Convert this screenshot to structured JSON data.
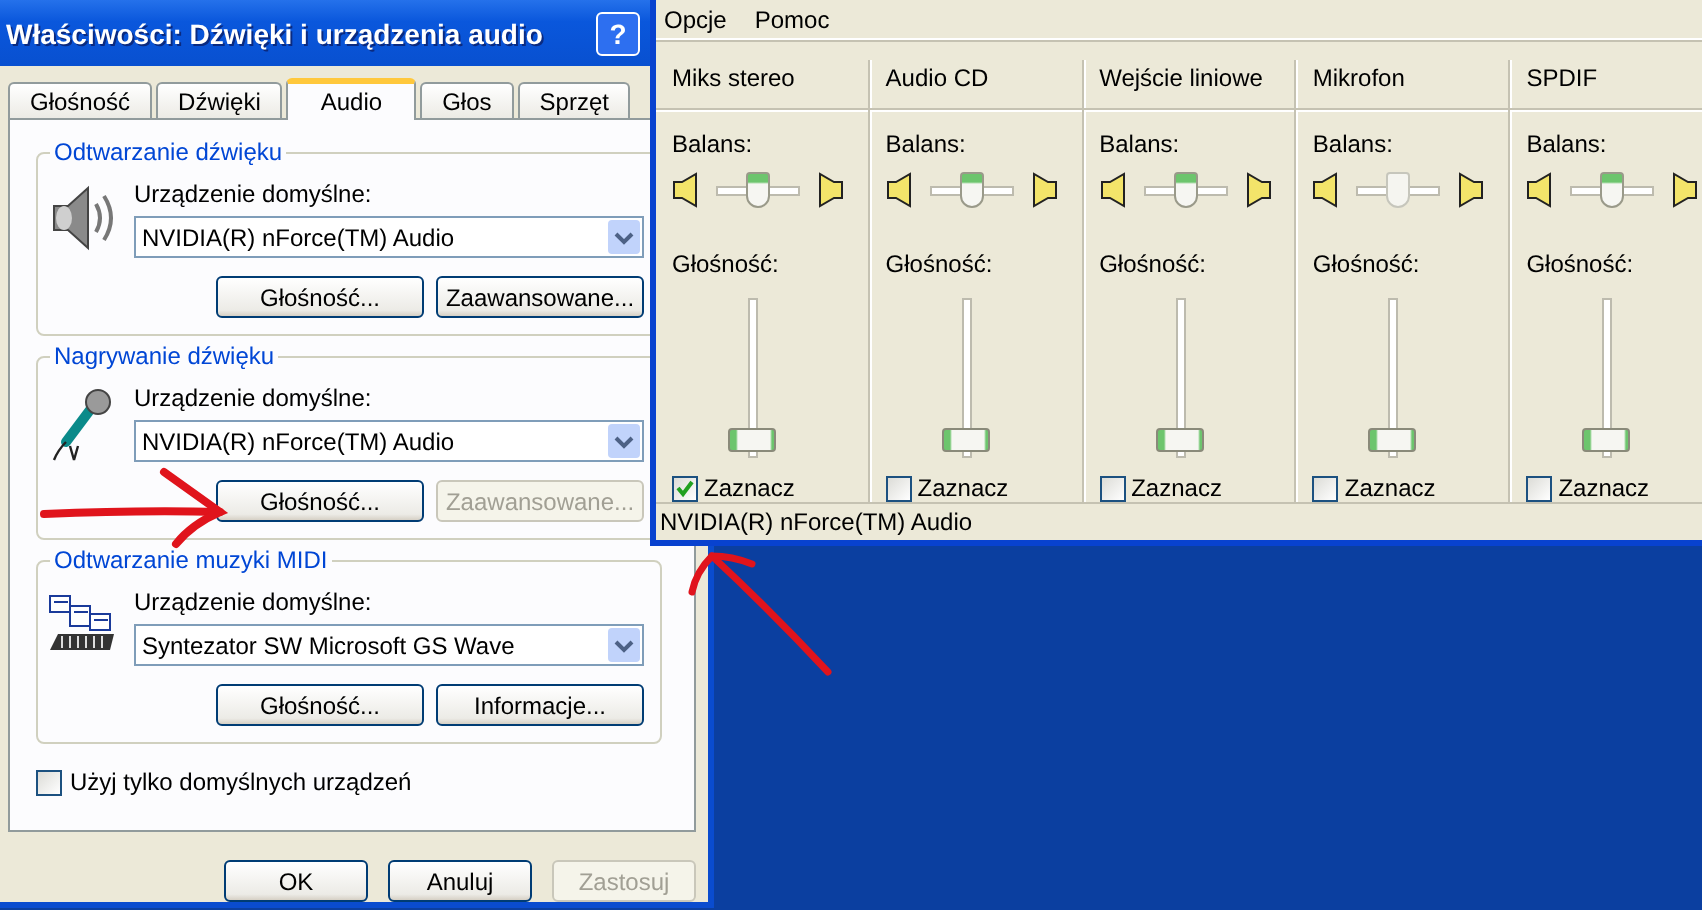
{
  "dialog": {
    "title": "Właściwości: Dźwięki i urządzenia audio",
    "help_button": "?",
    "tabs": [
      {
        "label": "Głośność",
        "selected": false
      },
      {
        "label": "Dźwięki",
        "selected": false
      },
      {
        "label": "Audio",
        "selected": true
      },
      {
        "label": "Głos",
        "selected": false
      },
      {
        "label": "Sprzęt",
        "selected": false
      }
    ],
    "groups": [
      {
        "kind": "speaker",
        "title": "Odtwarzanie dźwięku",
        "device_label": "Urządzenie domyślne:",
        "device": "NVIDIA(R) nForce(TM) Audio",
        "buttons": [
          {
            "label": "Głośność...",
            "disabled": false
          },
          {
            "label": "Zaawansowane...",
            "disabled": false
          }
        ]
      },
      {
        "kind": "microphone",
        "title": "Nagrywanie dźwięku",
        "device_label": "Urządzenie domyślne:",
        "device": "NVIDIA(R) nForce(TM) Audio",
        "buttons": [
          {
            "label": "Głośność...",
            "disabled": false
          },
          {
            "label": "Zaawansowane...",
            "disabled": true
          }
        ]
      },
      {
        "kind": "midi",
        "title": "Odtwarzanie muzyki MIDI",
        "device_label": "Urządzenie domyślne:",
        "device": "Syntezator SW Microsoft GS Wave",
        "buttons": [
          {
            "label": "Głośność...",
            "disabled": false
          },
          {
            "label": "Informacje...",
            "disabled": false
          }
        ]
      }
    ],
    "default_only": {
      "label": "Użyj tylko domyślnych urządzeń",
      "checked": false
    },
    "buttons": [
      {
        "label": "OK",
        "disabled": false
      },
      {
        "label": "Anuluj",
        "disabled": false
      },
      {
        "label": "Zastosuj",
        "disabled": true
      }
    ]
  },
  "mixer": {
    "menu": [
      "Opcje",
      "Pomoc"
    ],
    "channels": [
      {
        "name": "Miks stereo",
        "balance_label": "Balans:",
        "balance": {
          "level": 0.5,
          "disabled": false
        },
        "volume_label": "Głośność:",
        "volume": {
          "level": 0.05
        },
        "select_label": "Zaznacz",
        "selected": true
      },
      {
        "name": "Audio CD",
        "balance_label": "Balans:",
        "balance": {
          "level": 0.5,
          "disabled": false
        },
        "volume_label": "Głośność:",
        "volume": {
          "level": 0.05
        },
        "select_label": "Zaznacz",
        "selected": false
      },
      {
        "name": "Wejście liniowe",
        "balance_label": "Balans:",
        "balance": {
          "level": 0.5,
          "disabled": false
        },
        "volume_label": "Głośność:",
        "volume": {
          "level": 0.05
        },
        "select_label": "Zaznacz",
        "selected": false
      },
      {
        "name": "Mikrofon",
        "balance_label": "Balans:",
        "balance": {
          "level": 0.5,
          "disabled": true
        },
        "volume_label": "Głośność:",
        "volume": {
          "level": 0.05
        },
        "select_label": "Zaznacz",
        "selected": false
      },
      {
        "name": "SPDIF",
        "balance_label": "Balans:",
        "balance": {
          "level": 0.5,
          "disabled": false
        },
        "volume_label": "Głośność:",
        "volume": {
          "level": 0.05
        },
        "select_label": "Zaznacz",
        "selected": false
      }
    ],
    "status": "NVIDIA(R) nForce(TM) Audio"
  }
}
